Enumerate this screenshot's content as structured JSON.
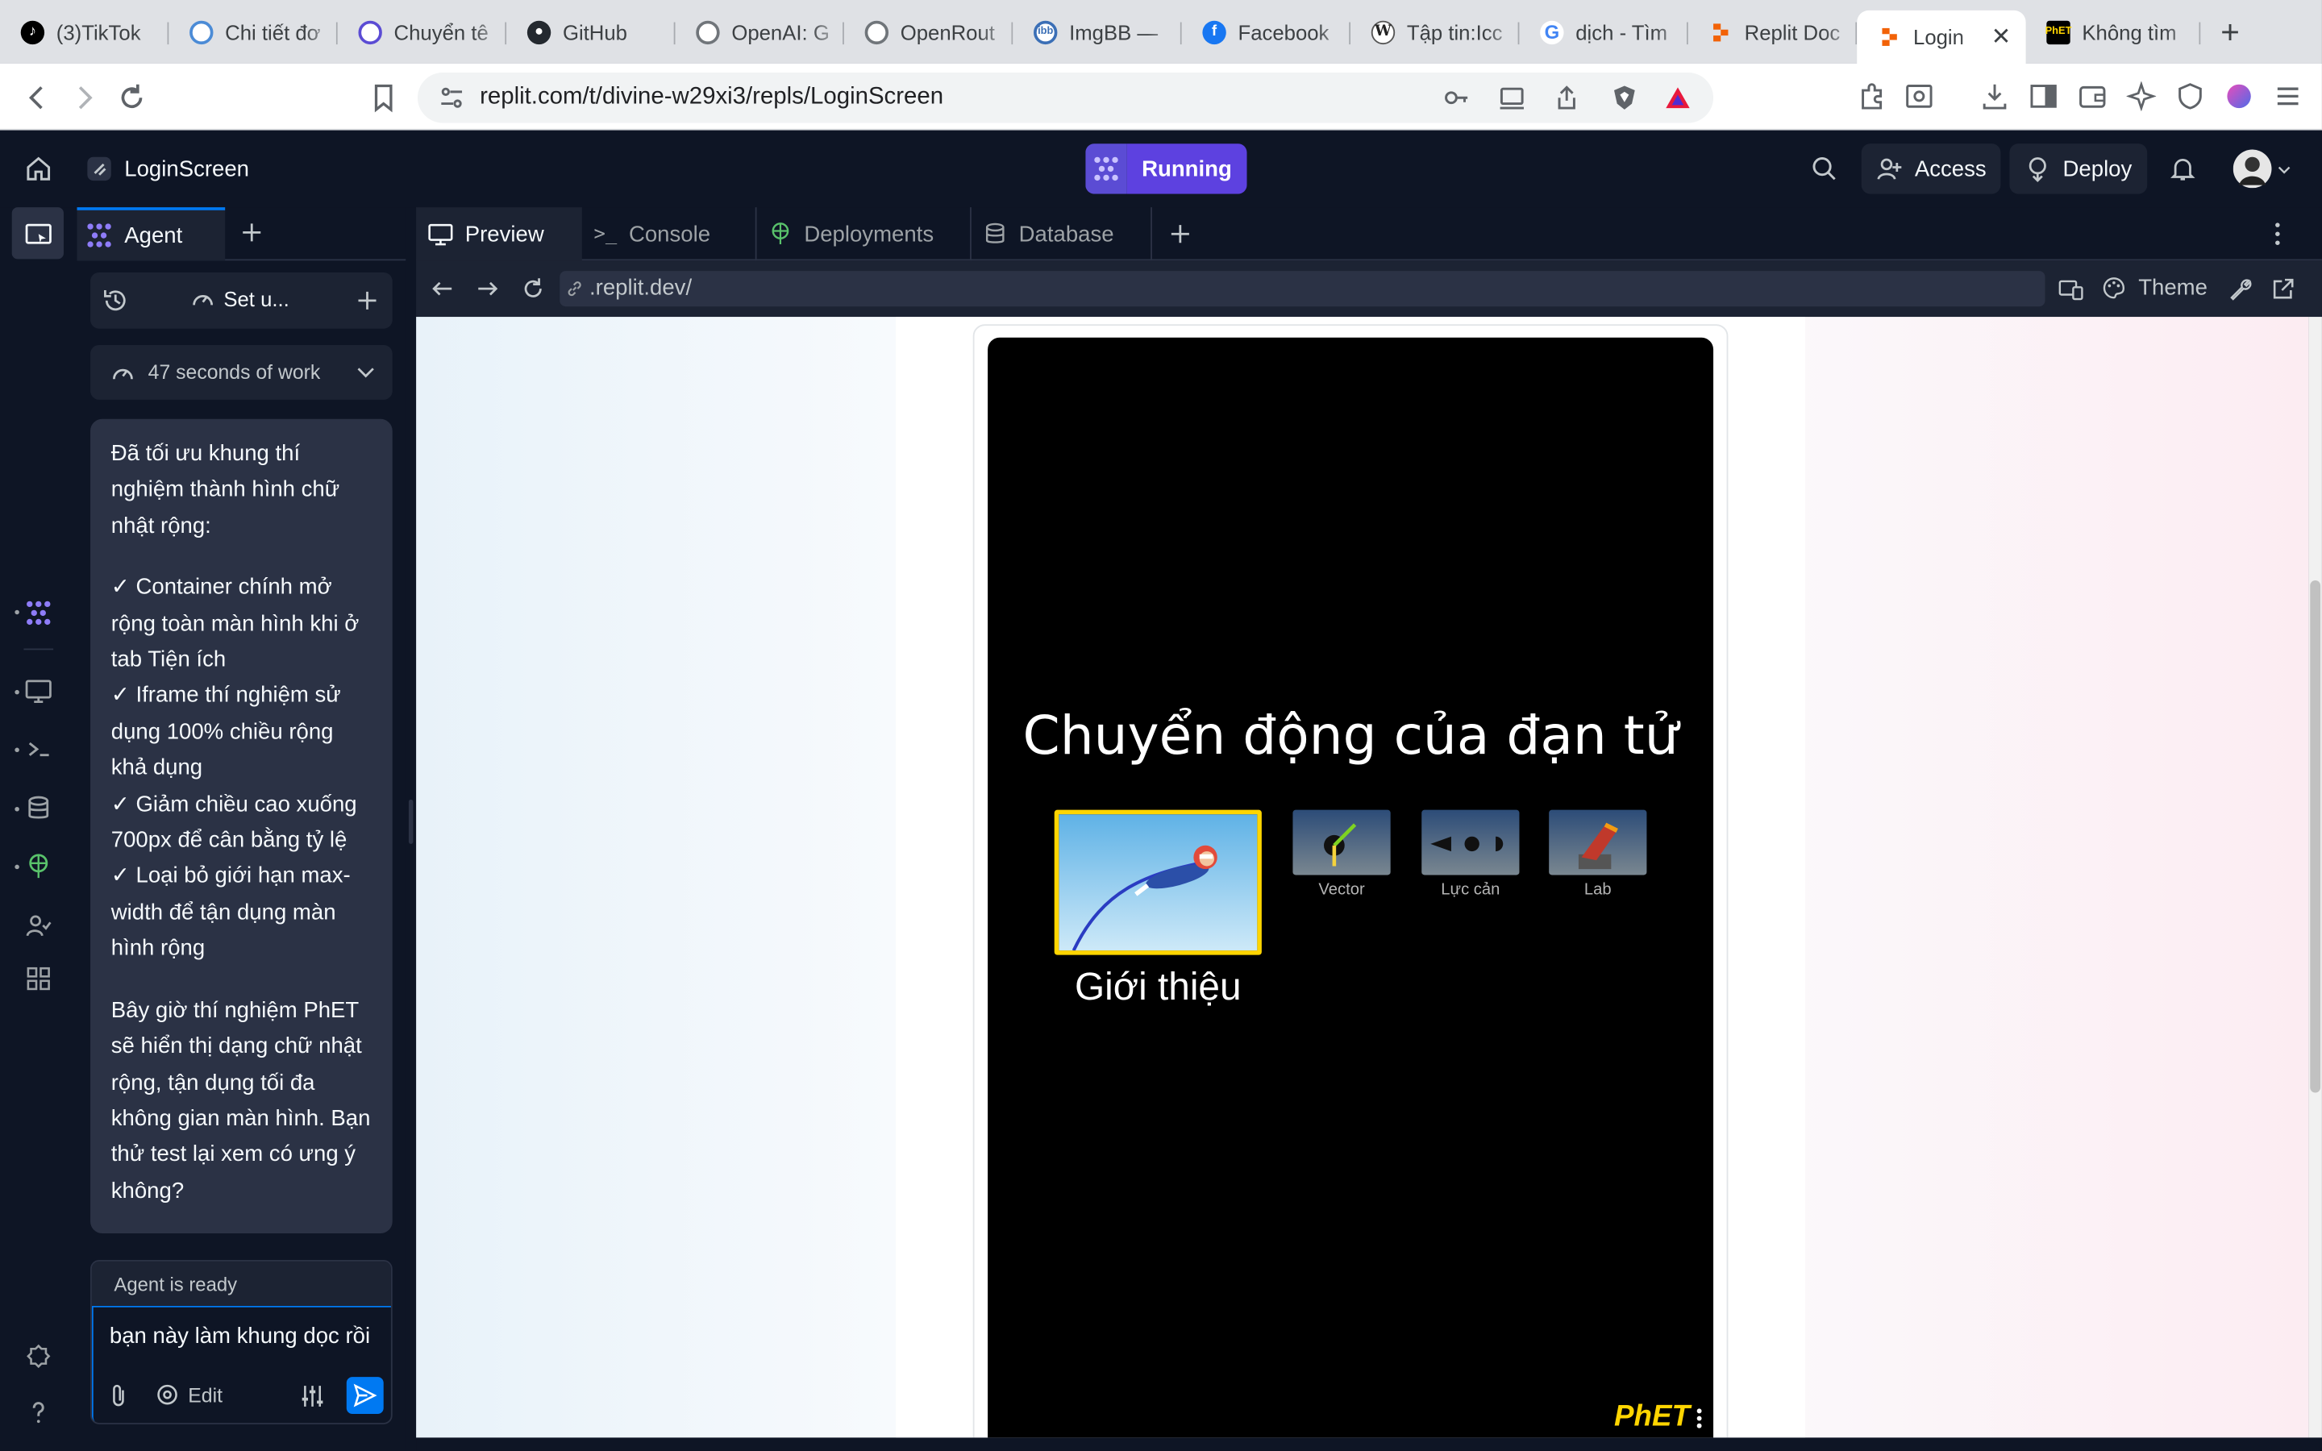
{
  "browser": {
    "tabs": [
      {
        "title": "(3)TikTok",
        "icon": "tiktok-icon"
      },
      {
        "title": "Chi tiết đơ",
        "icon": "chatgpt-icon"
      },
      {
        "title": "Chuyển tê",
        "icon": "openai-icon"
      },
      {
        "title": "GitHub",
        "icon": "github-icon"
      },
      {
        "title": "OpenAI: G",
        "icon": "openai-icon"
      },
      {
        "title": "OpenRout",
        "icon": "openrouter-icon"
      },
      {
        "title": "ImgBB —",
        "icon": "imgbb-icon"
      },
      {
        "title": "Facebook",
        "icon": "facebook-icon"
      },
      {
        "title": "Tập tin:Icc",
        "icon": "wikipedia-icon"
      },
      {
        "title": "dịch - Tìm",
        "icon": "google-icon"
      },
      {
        "title": "Replit Doc",
        "icon": "replit-icon"
      },
      {
        "title": "Login",
        "icon": "replit-icon",
        "active": true
      },
      {
        "title": "Không tìm",
        "icon": "phet-icon"
      }
    ],
    "url": "replit.com/t/divine-w29xi3/repls/LoginScreen"
  },
  "header": {
    "project_name": "LoginScreen",
    "run_status": "Running",
    "access_label": "Access",
    "deploy_label": "Deploy"
  },
  "agent": {
    "tab_label": "Agent",
    "session_label": "Set u...",
    "work_summary": "47 seconds of work",
    "message": {
      "intro": "Đã tối ưu khung thí nghiệm thành hình chữ nhật rộng:",
      "items": [
        "✓ Container chính mở rộng toàn màn hình khi ở tab Tiện ích",
        "✓ Iframe thí nghiệm sử dụng 100% chiều rộng khả dụng",
        "✓ Giảm chiều cao xuống 700px để cân bằng tỷ lệ",
        "✓ Loại bỏ giới hạn max-width để tận dụng màn hình rộng"
      ],
      "outro": "Bây giờ thí nghiệm PhET sẽ hiển thị dạng chữ nhật rộng, tận dụng tối đa không gian màn hình. Bạn thử test lại xem có ưng ý không?"
    },
    "status": "Agent is ready",
    "input_value": "bạn này làm khung dọc rồi",
    "edit_label": "Edit"
  },
  "workspace": {
    "tabs": [
      {
        "label": "Preview",
        "icon": "monitor-icon",
        "active": true
      },
      {
        "label": "Console",
        "icon": "terminal-icon"
      },
      {
        "label": "Deployments",
        "icon": "deploy-icon"
      },
      {
        "label": "Database",
        "icon": "database-icon"
      }
    ],
    "preview_url": ".replit.dev/",
    "theme_label": "Theme"
  },
  "simulation": {
    "title": "Chuyển động của đạn tử",
    "screens": [
      {
        "label": "Giới thiệu",
        "selected": true
      },
      {
        "label": "Vector"
      },
      {
        "label": "Lực cản"
      },
      {
        "label": "Lab"
      }
    ],
    "brand": "PhET"
  },
  "colors": {
    "replit_bg": "#0e1525",
    "replit_panel": "#1c2333",
    "replit_surface": "#2b3245",
    "accent_blue": "#0079f2",
    "run_purple": "#5d41e0",
    "phet_yellow": "#ffd500"
  }
}
